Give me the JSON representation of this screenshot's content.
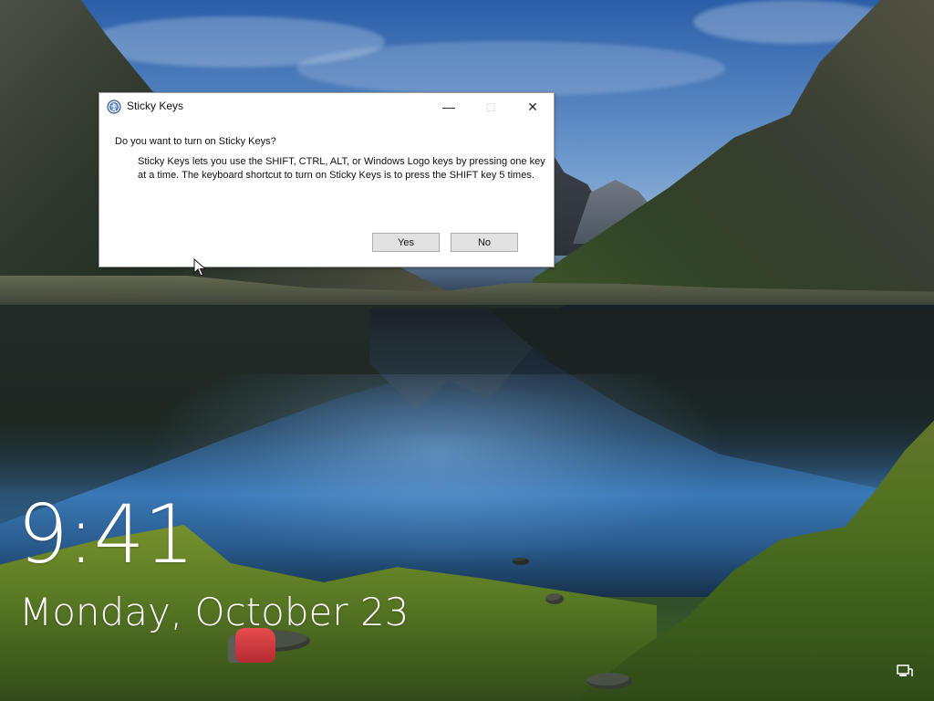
{
  "dialog": {
    "title": "Sticky Keys",
    "question": "Do you want to turn on Sticky Keys?",
    "description": "Sticky Keys lets you use the SHIFT, CTRL, ALT, or Windows Logo keys by pressing one key at a time. The keyboard shortcut to turn on Sticky Keys is to press the SHIFT key 5 times.",
    "yes_label": "Yes",
    "no_label": "No",
    "window_controls": {
      "minimize": "—",
      "maximize": "□",
      "close": "✕"
    }
  },
  "lockscreen": {
    "time": "9:41",
    "date": "Monday, October 23"
  },
  "icons": {
    "app": "accessibility-icon",
    "cursor": "mouse-pointer-icon",
    "network": "network-icon"
  }
}
